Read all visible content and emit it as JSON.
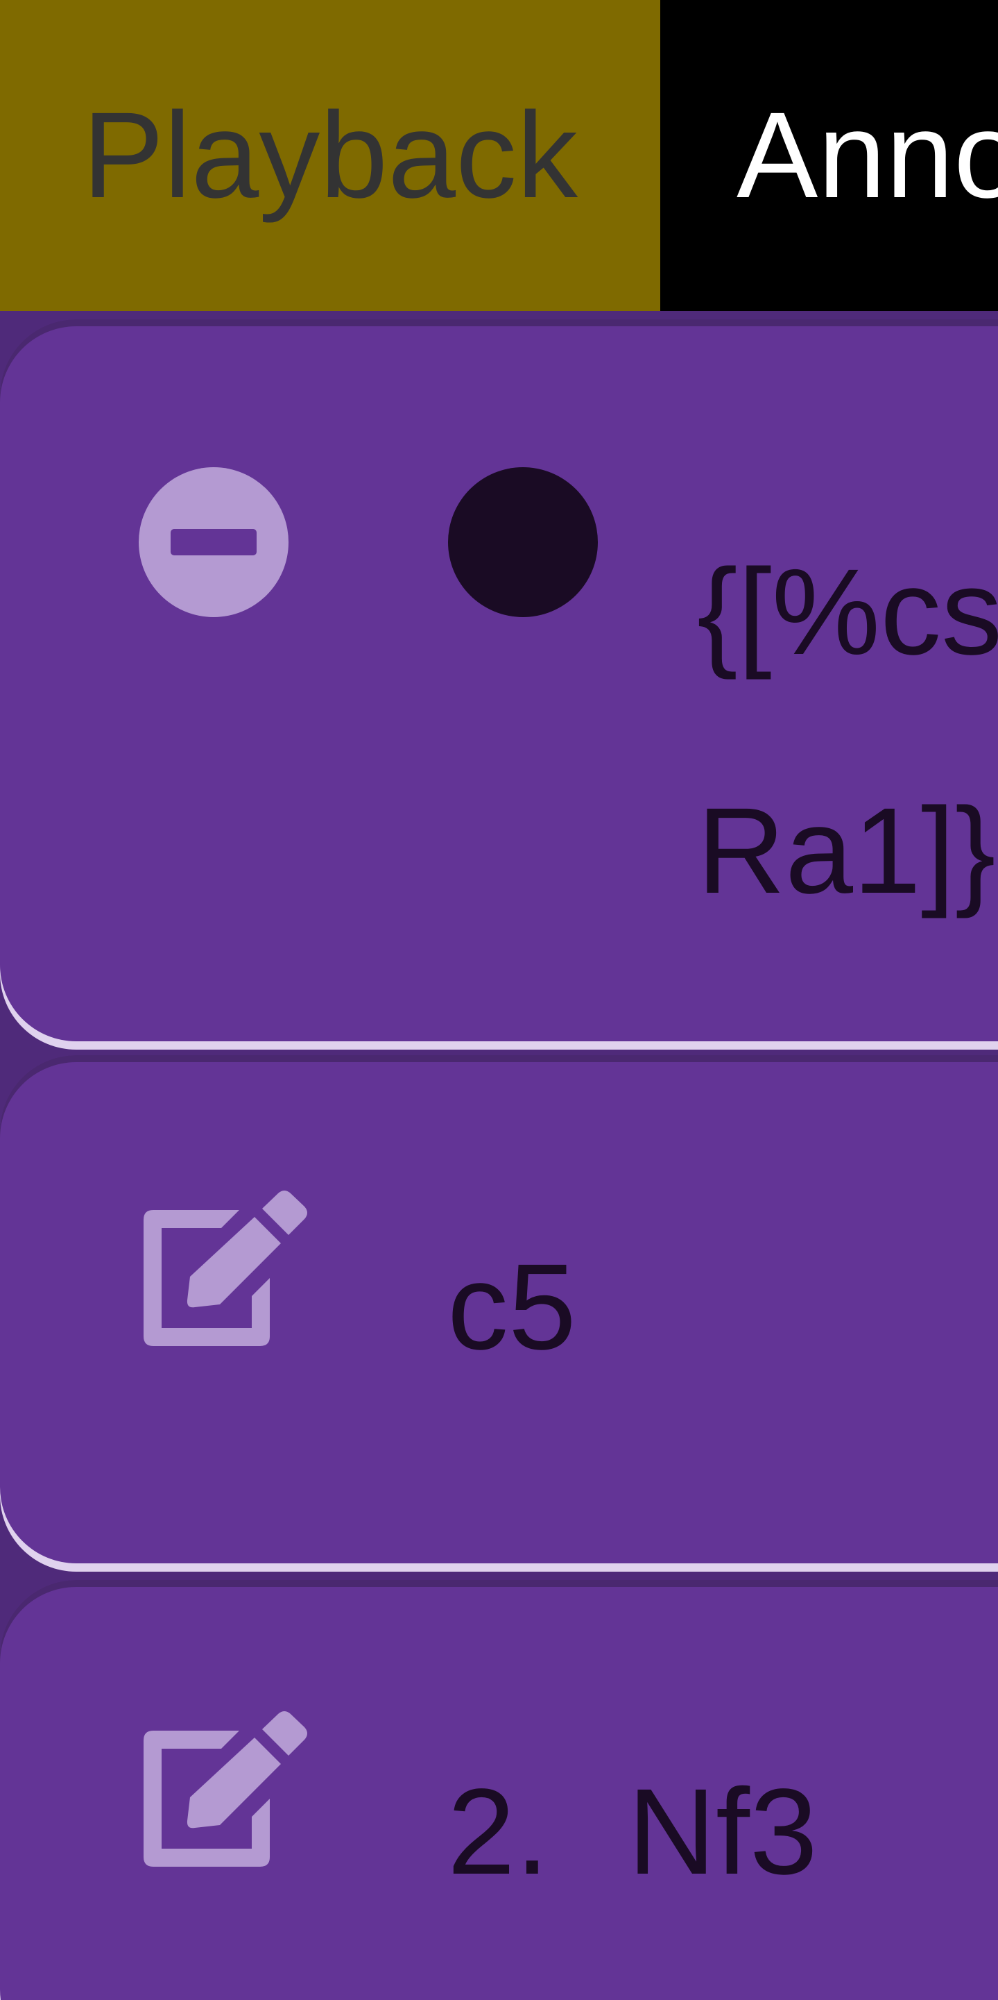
{
  "tabs": {
    "playback_label": "Playback",
    "annotate_label": "Anno"
  },
  "list": {
    "items": [
      {
        "kind": "comment",
        "text": "{[%cs Ra1]}",
        "remove_icon": "minus-circle-icon",
        "marker": "black-dot"
      },
      {
        "kind": "move",
        "icon": "edit-icon",
        "san": "c5"
      },
      {
        "kind": "move",
        "icon": "edit-icon",
        "number": "2.",
        "san": "Nf3"
      }
    ]
  },
  "colors": {
    "playback_tab_bg": "#7f6a00",
    "annotate_tab_bg": "#000000",
    "card_bg": "#633496",
    "icon": "#b49ad2",
    "text": "#1a0b24"
  }
}
